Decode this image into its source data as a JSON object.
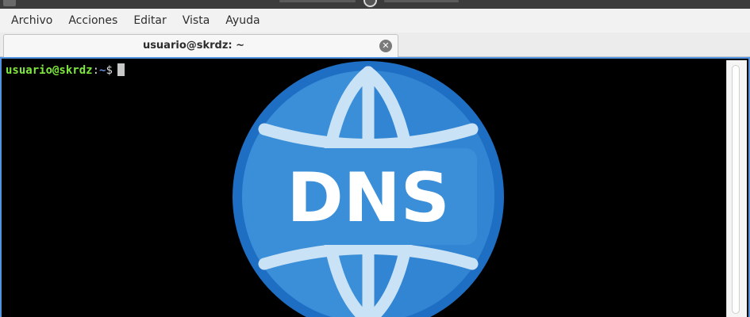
{
  "window": {
    "menu": [
      "Archivo",
      "Acciones",
      "Editar",
      "Vista",
      "Ayuda"
    ]
  },
  "tabs": [
    {
      "label": "usuario@skrdz: ~",
      "active": true
    }
  ],
  "terminal": {
    "prompt_user": "usuario@skrdz",
    "prompt_sep": ":",
    "prompt_path": "~",
    "prompt_symbol": "$"
  },
  "overlay": {
    "label": "DNS",
    "icon": "globe-icon"
  },
  "colors": {
    "accent": "#5294e2",
    "prompt_user": "#7ee83c",
    "prompt_path": "#6b8fe0",
    "globe_dark": "#1e6fc4",
    "globe_mid": "#3a8fd8",
    "globe_light": "#c9e2f6"
  }
}
